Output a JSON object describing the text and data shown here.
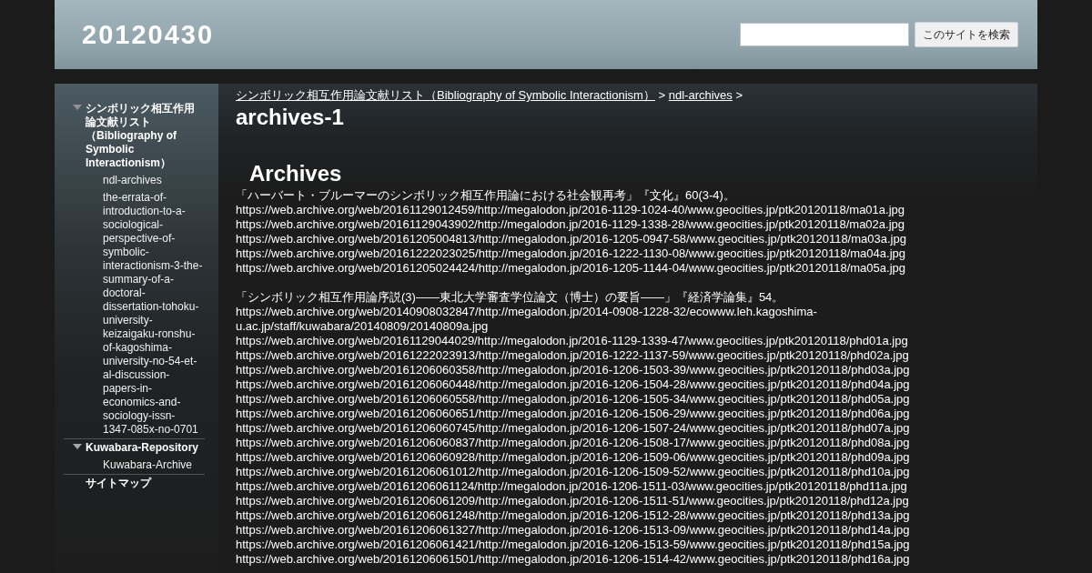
{
  "header": {
    "site_title": "20120430",
    "search": {
      "button": "このサイトを検索"
    }
  },
  "sidebar": {
    "items": [
      {
        "label": "シンボリック相互作用論文献リスト（Bibliography of Symbolic Interactionism）",
        "expanded": true,
        "children": [
          {
            "label": "ndl-archives"
          },
          {
            "label": "the-errata-of-introduction-to-a-sociological-perspective-of-symbolic-interactionism-3-the-summary-of-a-doctoral-dissertation-tohoku-university-keizaigaku-ronshu-of-kagoshima-university-no-54-et-al-discussion-papers-in-economics-and-sociology-issn-1347-085x-no-0701"
          }
        ]
      },
      {
        "label": "Kuwabara-Repository",
        "expanded": true,
        "children": [
          {
            "label": "Kuwabara-Archive"
          }
        ]
      },
      {
        "label": "サイトマップ"
      }
    ]
  },
  "breadcrumb": [
    {
      "kind": "link",
      "label": "シンボリック相互作用論文献リスト（Bibliography of Symbolic Interactionism）"
    },
    {
      "kind": "separator",
      "label": ">"
    },
    {
      "kind": "link",
      "label": "ndl-archives"
    },
    {
      "kind": "separator",
      "label": ">"
    }
  ],
  "page_title": "archives-1",
  "section_heading": "Archives",
  "entries": [
    {
      "citation": "「ハーバート・ブルーマーのシンボリック相互作用論における社会観再考」『文化』60(3-4)。",
      "urls": [
        "https://web.archive.org/web/20161129012459/http://megalodon.jp/2016-1129-1024-40/www.geocities.jp/ptk20120118/ma01a.jpg",
        "https://web.archive.org/web/20161129043902/http://megalodon.jp/2016-1129-1338-28/www.geocities.jp/ptk20120118/ma02a.jpg",
        "https://web.archive.org/web/20161205004813/http://megalodon.jp/2016-1205-0947-58/www.geocities.jp/ptk20120118/ma03a.jpg",
        "https://web.archive.org/web/20161222023025/http://megalodon.jp/2016-1222-1130-08/www.geocities.jp/ptk20120118/ma04a.jpg",
        "https://web.archive.org/web/20161205024424/http://megalodon.jp/2016-1205-1144-04/www.geocities.jp/ptk20120118/ma05a.jpg"
      ]
    },
    {
      "citation": "「シンボリック相互作用論序説(3)——東北大学審査学位論文（博士）の要旨——」『経済学論集』54。",
      "urls": [
        "https://web.archive.org/web/20140908032847/http://megalodon.jp/2014-0908-1228-32/ecowww.leh.kagoshima-u.ac.jp/staff/kuwabara/20140809/20140809a.jpg",
        "https://web.archive.org/web/20161129044029/http://megalodon.jp/2016-1129-1339-47/www.geocities.jp/ptk20120118/phd01a.jpg",
        "https://web.archive.org/web/20161222023913/http://megalodon.jp/2016-1222-1137-59/www.geocities.jp/ptk20120118/phd02a.jpg",
        "https://web.archive.org/web/20161206060358/http://megalodon.jp/2016-1206-1503-39/www.geocities.jp/ptk20120118/phd03a.jpg",
        "https://web.archive.org/web/20161206060448/http://megalodon.jp/2016-1206-1504-28/www.geocities.jp/ptk20120118/phd04a.jpg",
        "https://web.archive.org/web/20161206060558/http://megalodon.jp/2016-1206-1505-34/www.geocities.jp/ptk20120118/phd05a.jpg",
        "https://web.archive.org/web/20161206060651/http://megalodon.jp/2016-1206-1506-29/www.geocities.jp/ptk20120118/phd06a.jpg",
        "https://web.archive.org/web/20161206060745/http://megalodon.jp/2016-1206-1507-24/www.geocities.jp/ptk20120118/phd07a.jpg",
        "https://web.archive.org/web/20161206060837/http://megalodon.jp/2016-1206-1508-17/www.geocities.jp/ptk20120118/phd08a.jpg",
        "https://web.archive.org/web/20161206060928/http://megalodon.jp/2016-1206-1509-06/www.geocities.jp/ptk20120118/phd09a.jpg",
        "https://web.archive.org/web/20161206061012/http://megalodon.jp/2016-1206-1509-52/www.geocities.jp/ptk20120118/phd10a.jpg",
        "https://web.archive.org/web/20161206061124/http://megalodon.jp/2016-1206-1511-03/www.geocities.jp/ptk20120118/phd11a.jpg",
        "https://web.archive.org/web/20161206061209/http://megalodon.jp/2016-1206-1511-51/www.geocities.jp/ptk20120118/phd12a.jpg",
        "https://web.archive.org/web/20161206061248/http://megalodon.jp/2016-1206-1512-28/www.geocities.jp/ptk20120118/phd13a.jpg",
        "https://web.archive.org/web/20161206061327/http://megalodon.jp/2016-1206-1513-09/www.geocities.jp/ptk20120118/phd14a.jpg",
        "https://web.archive.org/web/20161206061421/http://megalodon.jp/2016-1206-1513-59/www.geocities.jp/ptk20120118/phd15a.jpg",
        "https://web.archive.org/web/20161206061501/http://megalodon.jp/2016-1206-1514-42/www.geocities.jp/ptk20120118/phd16a.jpg"
      ]
    }
  ]
}
